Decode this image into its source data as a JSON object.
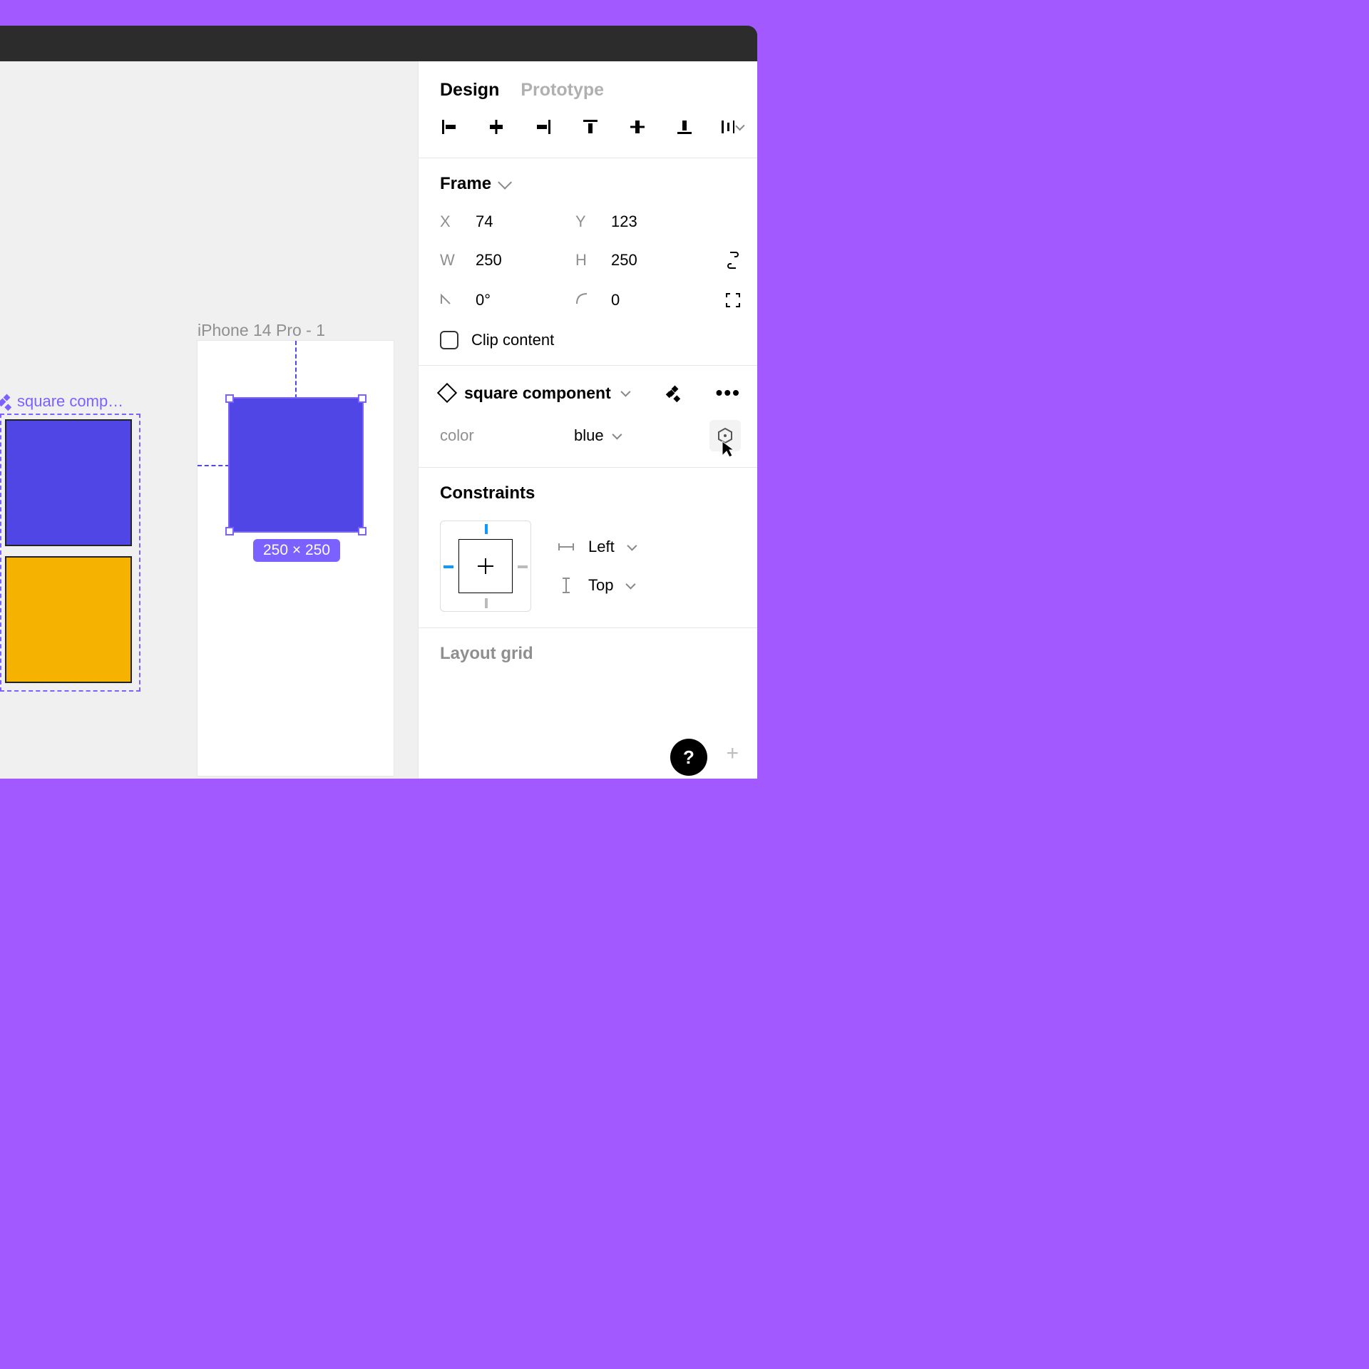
{
  "canvas": {
    "frame_label": "iPhone 14 Pro - 1",
    "dimensions_badge": "250 × 250",
    "component_label": "square comp…",
    "colors": {
      "instance_fill": "#4F46E5",
      "variant_blue_fill": "#4F46E5",
      "variant_yellow_fill": "#F5B300",
      "selection_stroke": "#7B61FF",
      "badge_bg": "#7B61FF"
    }
  },
  "panel": {
    "tabs": {
      "design": "Design",
      "prototype": "Prototype",
      "active": "design"
    },
    "alignment": {
      "items": [
        "align-left",
        "align-h-center",
        "align-right",
        "align-top",
        "align-v-center",
        "align-bottom",
        "distribute"
      ]
    },
    "frame": {
      "title": "Frame",
      "x_label": "X",
      "x": "74",
      "y_label": "Y",
      "y": "123",
      "w_label": "W",
      "w": "250",
      "h_label": "H",
      "h": "250",
      "rotation_label": "⟀",
      "rotation": "0°",
      "radius_label": "⌒",
      "radius": "0",
      "clip_label": "Clip content",
      "clip_checked": false
    },
    "component": {
      "name": "square component",
      "prop_label": "color",
      "prop_value": "blue"
    },
    "constraints": {
      "title": "Constraints",
      "horizontal": "Left",
      "vertical": "Top"
    },
    "layout_grid": {
      "title": "Layout grid"
    },
    "help": "?"
  }
}
